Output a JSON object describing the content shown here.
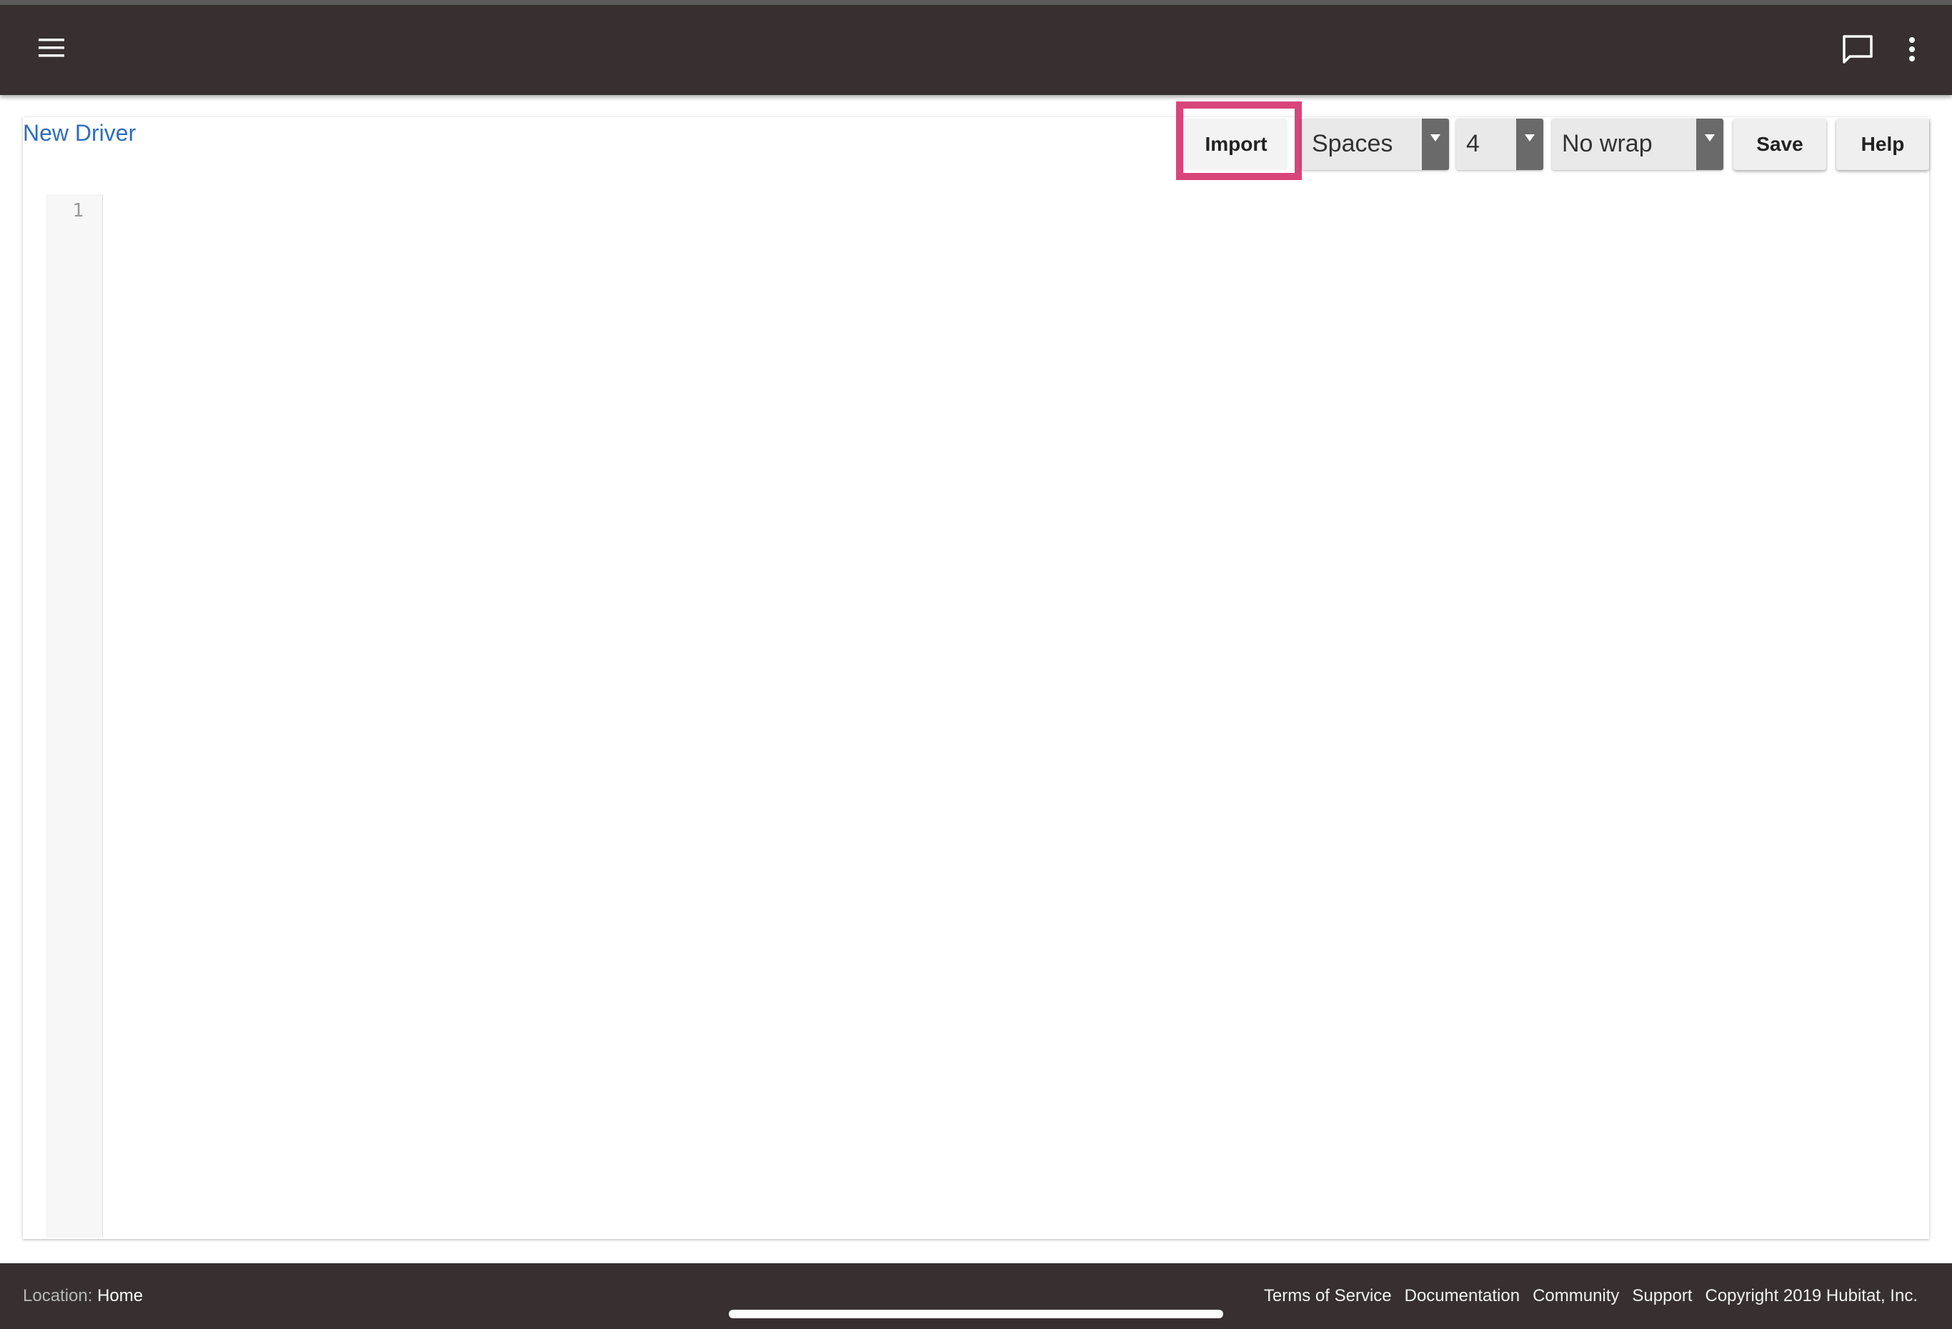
{
  "header": {
    "menu_icon": "hamburger-menu-icon",
    "chat_icon": "chat-bubble-icon",
    "more_icon": "more-vertical-icon"
  },
  "editor": {
    "title": "New Driver",
    "toolbar": {
      "import_label": "Import",
      "indent_type": "Spaces",
      "indent_size": "4",
      "wrap_mode": "No wrap",
      "save_label": "Save",
      "help_label": "Help"
    },
    "line_numbers": [
      "1"
    ]
  },
  "footer": {
    "location_label": "Location:",
    "location_value": "Home",
    "links": {
      "terms": "Terms of Service",
      "docs": "Documentation",
      "community": "Community",
      "support": "Support",
      "copyright": "Copyright 2019 Hubitat, Inc."
    }
  },
  "colors": {
    "appbar": "#383030",
    "title_link": "#2e6dbb",
    "highlight": "#d8457a"
  }
}
